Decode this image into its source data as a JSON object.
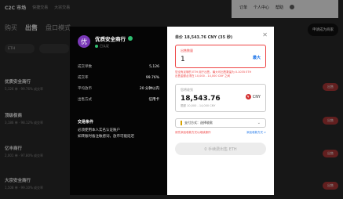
{
  "topnav": {
    "brand": "C2C 市场",
    "items": [
      "快捷交易",
      "大宗交易"
    ],
    "right": [
      "订单",
      "个人中心",
      "帮助"
    ]
  },
  "tabs": [
    "购买",
    "出售",
    "盘口模式"
  ],
  "merchant_btn": "申请成为商家",
  "filters": [
    "ETH",
    ""
  ],
  "rows": [
    {
      "name": "优质安全商行",
      "meta": "5,126 单 · 99.76% 成交率",
      "btn": "出售"
    },
    {
      "name": "顶级极商",
      "meta": "3,186 单 · 98.12% 成交率",
      "btn": "出售"
    },
    {
      "name": "亿丰商行",
      "meta": "2,001 单 · 97.80% 成交率",
      "btn": "出售"
    },
    {
      "name": "大宗安全商行",
      "meta": "1,508 单 · 99.10% 成交率",
      "btn": "出售"
    }
  ],
  "modal": {
    "merchant": {
      "avatar": "优",
      "name": "优质安全商行",
      "sub": "已认证"
    },
    "stats": [
      {
        "k": "成交单数",
        "v": "5,126"
      },
      {
        "k": "成交率",
        "v": "99.76%"
      },
      {
        "k": "平均放币",
        "v": "20 分钟以内"
      },
      {
        "k": "出售方式",
        "v": "信用卡"
      }
    ],
    "terms": {
      "title": "交易条件",
      "lines": [
        "必须使用本人实名认证账户",
        "如转账时备注敏感词，放币可能延迟"
      ]
    },
    "price": "单价 18,543.76 CNY (35 秒)",
    "sell_amount": {
      "label": "出售数量",
      "value": "1",
      "max": "最大"
    },
    "error": "您没有足够的 ETH 用于出售，最大可出售数量为 0.1035 ETH\n出售金额必须在 10,000 - 14,000 CNY 之间",
    "receive": {
      "label": "您将收到",
      "value": "18,543.76",
      "currency": "CNY",
      "range": "限额 10,000 - 14,000 CNY"
    },
    "payment": {
      "label": "支付方式：选择收款",
      "warn": "请先添加收款方式以继续操作",
      "add": "添加收款方式 >"
    },
    "submit": "0 手续费出售 ETH"
  }
}
